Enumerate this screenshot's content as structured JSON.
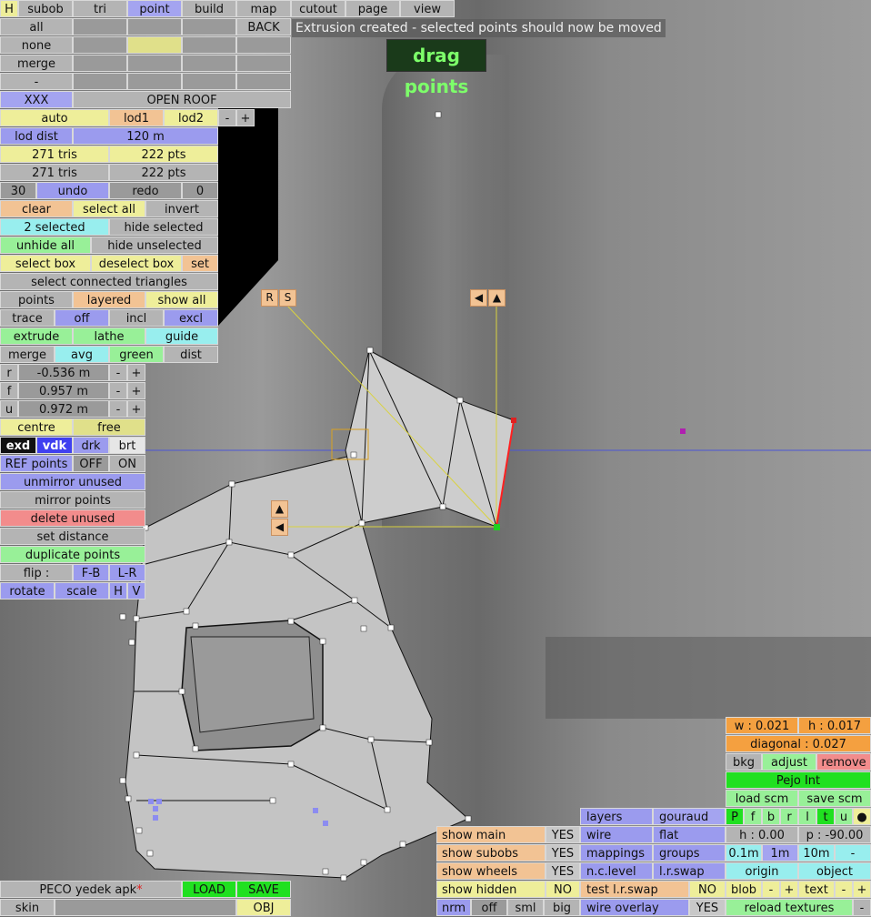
{
  "tabs": [
    "H",
    "subob",
    "tri",
    "point",
    "build",
    "map",
    "cutout",
    "page",
    "view"
  ],
  "active_tab": "point",
  "status_message": "Extrusion created - selected points should now be moved",
  "mode_badge": "drag points",
  "left": {
    "all": "all",
    "none": "none",
    "merge": "merge",
    "dash": "-",
    "back": "BACK",
    "xxx": "XXX",
    "open_roof": "OPEN ROOF",
    "auto": "auto",
    "lod1": "lod1",
    "lod2": "lod2",
    "minus": "-",
    "plus": "+",
    "lod_dist": "lod dist",
    "lod_dist_value": "120 m",
    "tris1": "271 tris",
    "pts1": "222 pts",
    "tris2": "271 tris",
    "pts2": "222 pts",
    "undo_count": "30",
    "undo": "undo",
    "redo": "redo",
    "redo_count": "0",
    "clear": "clear",
    "select_all": "select all",
    "invert": "invert",
    "selected": "2 selected",
    "hide_selected": "hide selected",
    "unhide_all": "unhide all",
    "hide_unselected": "hide unselected",
    "select_box": "select box",
    "deselect_box": "deselect box",
    "set": "set",
    "select_connected": "select connected triangles",
    "points": "points",
    "layered": "layered",
    "show_all": "show all",
    "trace": "trace",
    "off": "off",
    "incl": "incl",
    "excl": "excl",
    "extrude": "extrude",
    "lathe": "lathe",
    "guide": "guide",
    "merge2": "merge",
    "avg": "avg",
    "green": "green",
    "dist": "dist",
    "r": "r",
    "r_val": "-0.536 m",
    "f": "f",
    "f_val": "0.957 m",
    "u": "u",
    "u_val": "0.972 m",
    "centre": "centre",
    "free": "free",
    "exd": "exd",
    "vdk": "vdk",
    "drk": "drk",
    "brt": "brt",
    "ref_points": "REF points",
    "ref_off": "OFF",
    "ref_on": "ON",
    "unmirror": "unmirror unused",
    "mirror": "mirror points",
    "delete_unused": "delete unused",
    "set_distance": "set distance",
    "duplicate": "duplicate points",
    "flip": "flip :",
    "fb": "F-B",
    "lr": "L-R",
    "rotate": "rotate",
    "scale": "scale",
    "h": "H",
    "v": "V"
  },
  "handles": {
    "r": "R",
    "s": "S",
    "left_arrow": "◀",
    "up_arrow": "▲"
  },
  "bottom_left": {
    "file": "PECO yedek apk",
    "star": "*",
    "load": "LOAD",
    "save": "SAVE",
    "skin": "skin",
    "obj": "OBJ"
  },
  "show": {
    "main": "show main",
    "main_v": "YES",
    "subobs": "show subobs",
    "subobs_v": "YES",
    "wheels": "show wheels",
    "wheels_v": "YES",
    "hidden": "show hidden",
    "hidden_v": "NO",
    "nrm": "nrm",
    "off": "off",
    "sml": "sml",
    "big": "big"
  },
  "render": {
    "layers": "layers",
    "gouraud": "gouraud",
    "wire": "wire",
    "flat": "flat",
    "mappings": "mappings",
    "groups": "groups",
    "nc_level": "n.c.level",
    "lr_swap": "l.r.swap",
    "test_lr_swap": "test l.r.swap",
    "test_v": "NO",
    "wire_overlay": "wire overlay",
    "wire_overlay_v": "YES"
  },
  "right": {
    "w": "w : 0.021",
    "h": "h : 0.017",
    "diagonal": "diagonal : 0.027",
    "bkg": "bkg",
    "adjust": "adjust",
    "remove": "remove",
    "name": "Pejo Int",
    "load_scm": "load scm",
    "save_scm": "save scm",
    "pfb": [
      "P",
      "f",
      "b",
      "r",
      "l",
      "t",
      "u",
      "●"
    ],
    "h_val": "h : 0.00",
    "p_val": "p : -90.00",
    "s01": "0.1m",
    "s1": "1m",
    "s10": "10m",
    "sm": "-",
    "origin": "origin",
    "object": "object",
    "blob": "blob",
    "text": "text",
    "reload": "reload textures",
    "minus": "-",
    "plus": "+"
  },
  "colors": {
    "accent_blue": "#9b9bee",
    "selected_yellow": "#eeee9a",
    "orange": "#f2c394",
    "green": "#98f098"
  }
}
